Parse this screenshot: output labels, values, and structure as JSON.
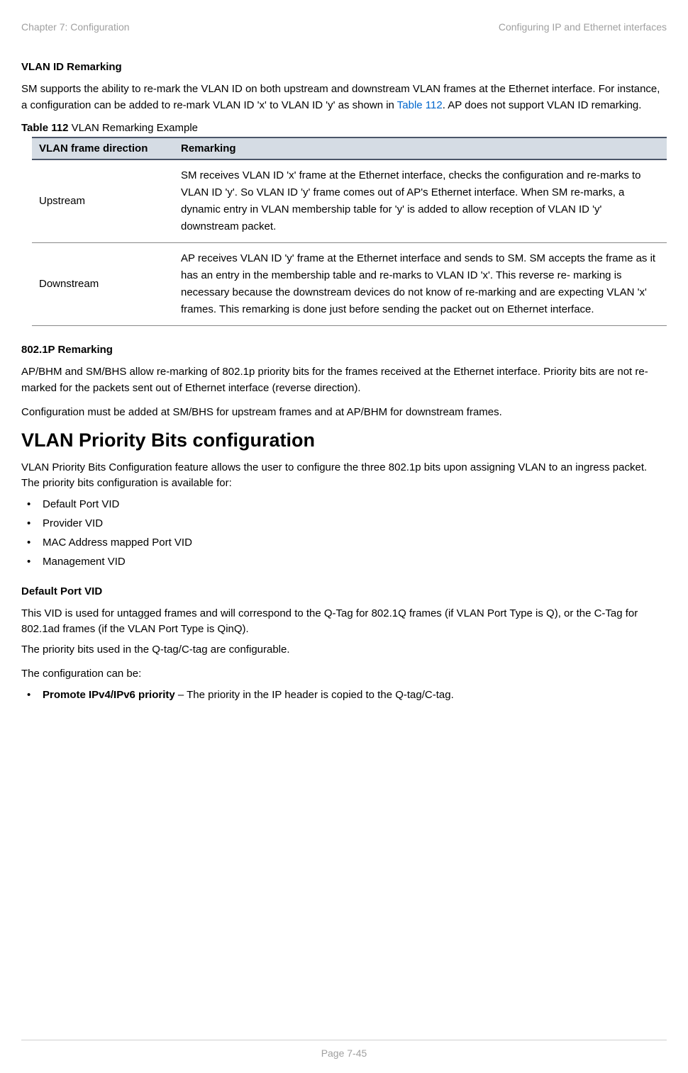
{
  "header": {
    "left": "Chapter 7:  Configuration",
    "right": "Configuring IP and Ethernet interfaces"
  },
  "section1": {
    "heading": "VLAN ID Remarking",
    "para_pre": "SM supports the ability to re-mark the VLAN ID on both upstream and downstream VLAN frames at the Ethernet interface. For instance, a configuration can be added to re-mark VLAN ID 'x' to VLAN ID 'y' as shown in ",
    "para_link": "Table 112",
    "para_post": ". AP does not support VLAN ID remarking."
  },
  "table": {
    "caption_bold": "Table 112",
    "caption_rest": " VLAN Remarking Example",
    "headers": {
      "col1": "VLAN frame direction",
      "col2": "Remarking"
    },
    "rows": [
      {
        "direction": "Upstream",
        "remarking": "SM receives VLAN ID 'x' frame at the Ethernet interface, checks the configuration and re-marks to VLAN ID 'y'. So VLAN ID 'y' frame comes out of AP's Ethernet interface. When SM re-marks, a dynamic entry in VLAN membership table for 'y' is added to allow reception of VLAN ID 'y' downstream packet."
      },
      {
        "direction": "Downstream",
        "remarking": "AP receives VLAN ID 'y' frame at the Ethernet interface and sends to SM. SM accepts the frame as it has an entry in the membership table and re-marks to VLAN ID 'x'. This reverse re- marking is necessary because the downstream devices do not know of re-marking and are expecting VLAN 'x' frames. This remarking is done just before sending the packet out on Ethernet interface."
      }
    ]
  },
  "section2": {
    "heading": "802.1P Remarking",
    "para1": "AP/BHM and SM/BHS allow re-marking of 802.1p priority bits for the frames received at the Ethernet interface. Priority bits are not re-marked for the packets sent out of Ethernet interface (reverse direction).",
    "para2": "Configuration must be added at SM/BHS for upstream frames and at AP/BHM for downstream frames."
  },
  "section3": {
    "heading": "VLAN Priority Bits configuration",
    "para": "VLAN Priority Bits Configuration feature allows the user to configure the three 802.1p bits upon assigning VLAN to an ingress packet. The priority bits configuration is available for:",
    "bullets": [
      "Default Port VID",
      "Provider VID",
      "MAC Address mapped Port VID",
      "Management VID"
    ]
  },
  "section4": {
    "heading": "Default Port VID",
    "para1": "This VID is used for untagged frames and will correspond to the Q-Tag for 802.1Q frames (if VLAN Port Type is Q), or the C-Tag for 802.1ad frames (if the VLAN Port Type is QinQ).",
    "para2": "The priority bits used in the Q-tag/C-tag are configurable.",
    "para3": "The configuration can be:",
    "bullet_bold": "Promote IPv4/IPv6 priority",
    "bullet_rest": " – The priority in the IP header is copied to the Q-tag/C-tag."
  },
  "footer": {
    "text": "Page 7-45"
  }
}
